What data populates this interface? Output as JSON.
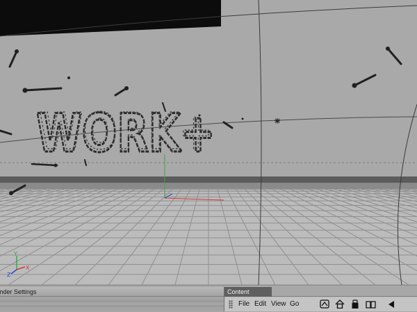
{
  "panels": {
    "render_settings": {
      "tab_label": "Render Settings"
    },
    "content_browser": {
      "title": "Content Browser",
      "menu": {
        "file": "File",
        "edit": "Edit",
        "view": "View",
        "go": "Go"
      },
      "toolbar_icons": [
        "navigate-icon",
        "home-icon",
        "lock-icon",
        "book-icon",
        "back-arrow-icon"
      ]
    }
  },
  "viewport": {
    "object_text": "WORK+",
    "colors": {
      "background": "#a9a9a9",
      "floor": "#bcbcbc",
      "floor_grid": "#8f8f8f",
      "horizon_band": "#5c5c5c",
      "object": "#2a2a2a",
      "axis_x": "#d23a3a",
      "axis_y": "#2fae3c",
      "axis_z": "#2d48c8"
    },
    "axis_labels": {
      "x": "X",
      "y": "Y",
      "z": "Z"
    }
  }
}
